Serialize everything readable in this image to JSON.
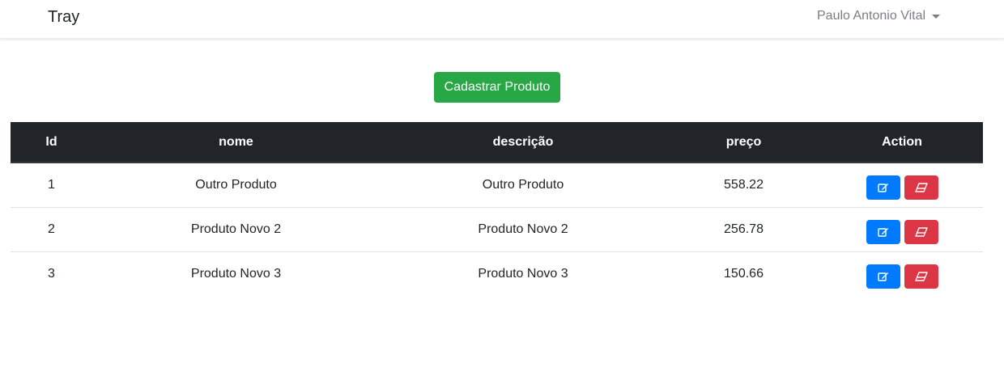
{
  "navbar": {
    "brand": "Tray",
    "user_name": "Paulo Antonio Vital"
  },
  "actions": {
    "create_label": "Cadastrar Produto"
  },
  "table": {
    "headers": [
      "Id",
      "nome",
      "descrição",
      "preço",
      "Action"
    ],
    "rows": [
      {
        "id": "1",
        "nome": "Outro Produto",
        "descricao": "Outro Produto",
        "preco": "558.22"
      },
      {
        "id": "2",
        "nome": "Produto Novo 2",
        "descricao": "Produto Novo 2",
        "preco": "256.78"
      },
      {
        "id": "3",
        "nome": "Produto Novo 3",
        "descricao": "Produto Novo 3",
        "preco": "150.66"
      }
    ],
    "row_actions": [
      {
        "name": "edit",
        "icon": "edit-icon",
        "color": "#007bff"
      },
      {
        "name": "delete",
        "icon": "eraser-icon",
        "color": "#dc3545"
      }
    ]
  },
  "colors": {
    "primary": "#007bff",
    "success": "#28a745",
    "danger": "#dc3545",
    "dark": "#212529"
  }
}
